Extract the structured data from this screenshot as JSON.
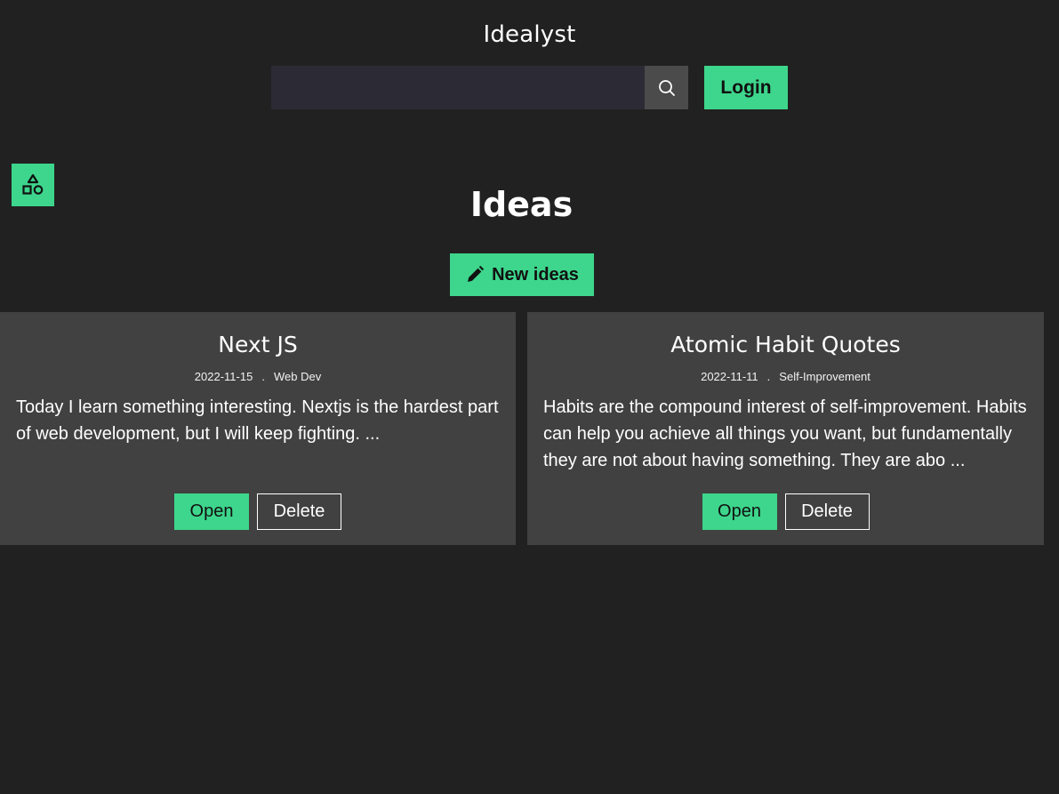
{
  "header": {
    "brand": "Idealyst",
    "search": {
      "value": "",
      "placeholder": "",
      "button_icon": "search-icon"
    },
    "login_label": "Login"
  },
  "sidebar_toggle": {
    "icon": "shapes-icon"
  },
  "main": {
    "title": "Ideas",
    "new_button": {
      "label": "New ideas",
      "icon": "pencil-icon"
    },
    "ideas": [
      {
        "title": "Next JS",
        "date": "2022-11-15",
        "separator": ".",
        "category": "Web Dev",
        "excerpt": "Today I learn something interesting. Nextjs is the hardest part of web development, but I will keep fighting. ...",
        "open_label": "Open",
        "delete_label": "Delete"
      },
      {
        "title": "Atomic Habit Quotes",
        "date": "2022-11-11",
        "separator": ".",
        "category": "Self-Improvement",
        "excerpt": "Habits are the compound interest of self-improvement. Habits can help you achieve all things you want, but fundamentally they are not about having something. They are abo ...",
        "open_label": "Open",
        "delete_label": "Delete"
      }
    ]
  },
  "colors": {
    "background": "#212121",
    "card": "#414141",
    "accent": "#3dd68c",
    "search_input": "#2c2b35",
    "search_button": "#4b4b4b"
  }
}
